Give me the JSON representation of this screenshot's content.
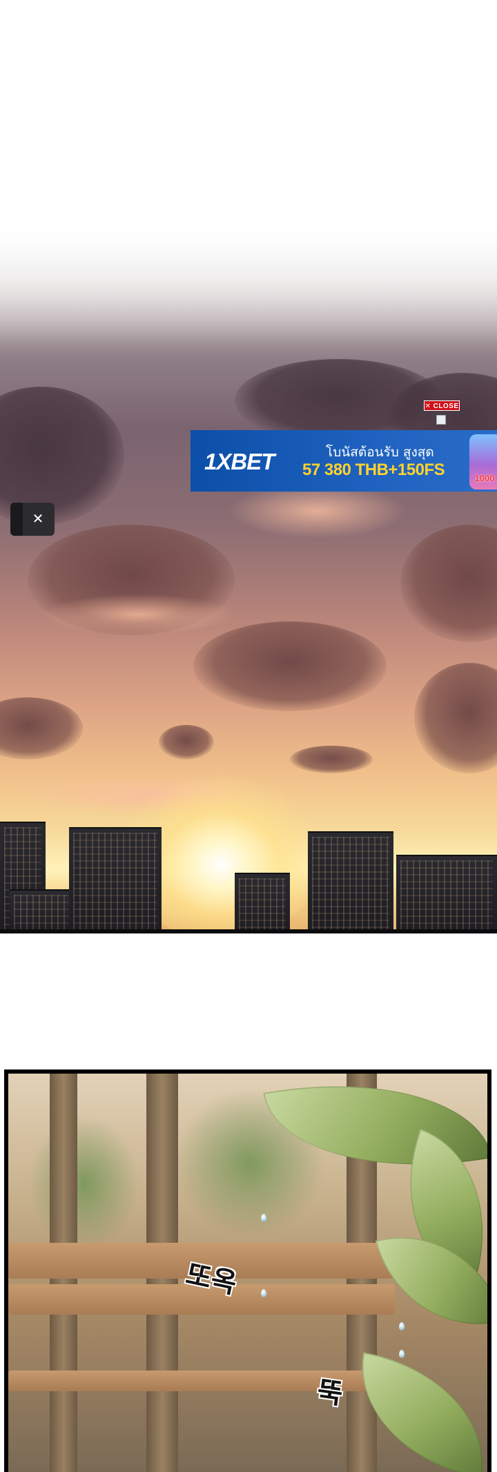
{
  "ad": {
    "close_label": "✕ CLOSE",
    "brand": "1XBET",
    "headline": "โบนัสต้อนรับ สูงสุด",
    "offer": "57 380 THB+150FS",
    "badge_text": "1000",
    "brand_color": "#1f62bf",
    "offer_color": "#ffd22e",
    "close_tag_color": "#d0101a"
  },
  "overlay": {
    "close_button_label": "✕",
    "close_icon": "close-icon"
  },
  "panels": {
    "panel_1": {
      "scene": "sunset-city-sky"
    },
    "panel_2": {
      "scene": "park-bench-with-leaves",
      "sound_effects": [
        "또옥",
        "뚝"
      ]
    }
  }
}
